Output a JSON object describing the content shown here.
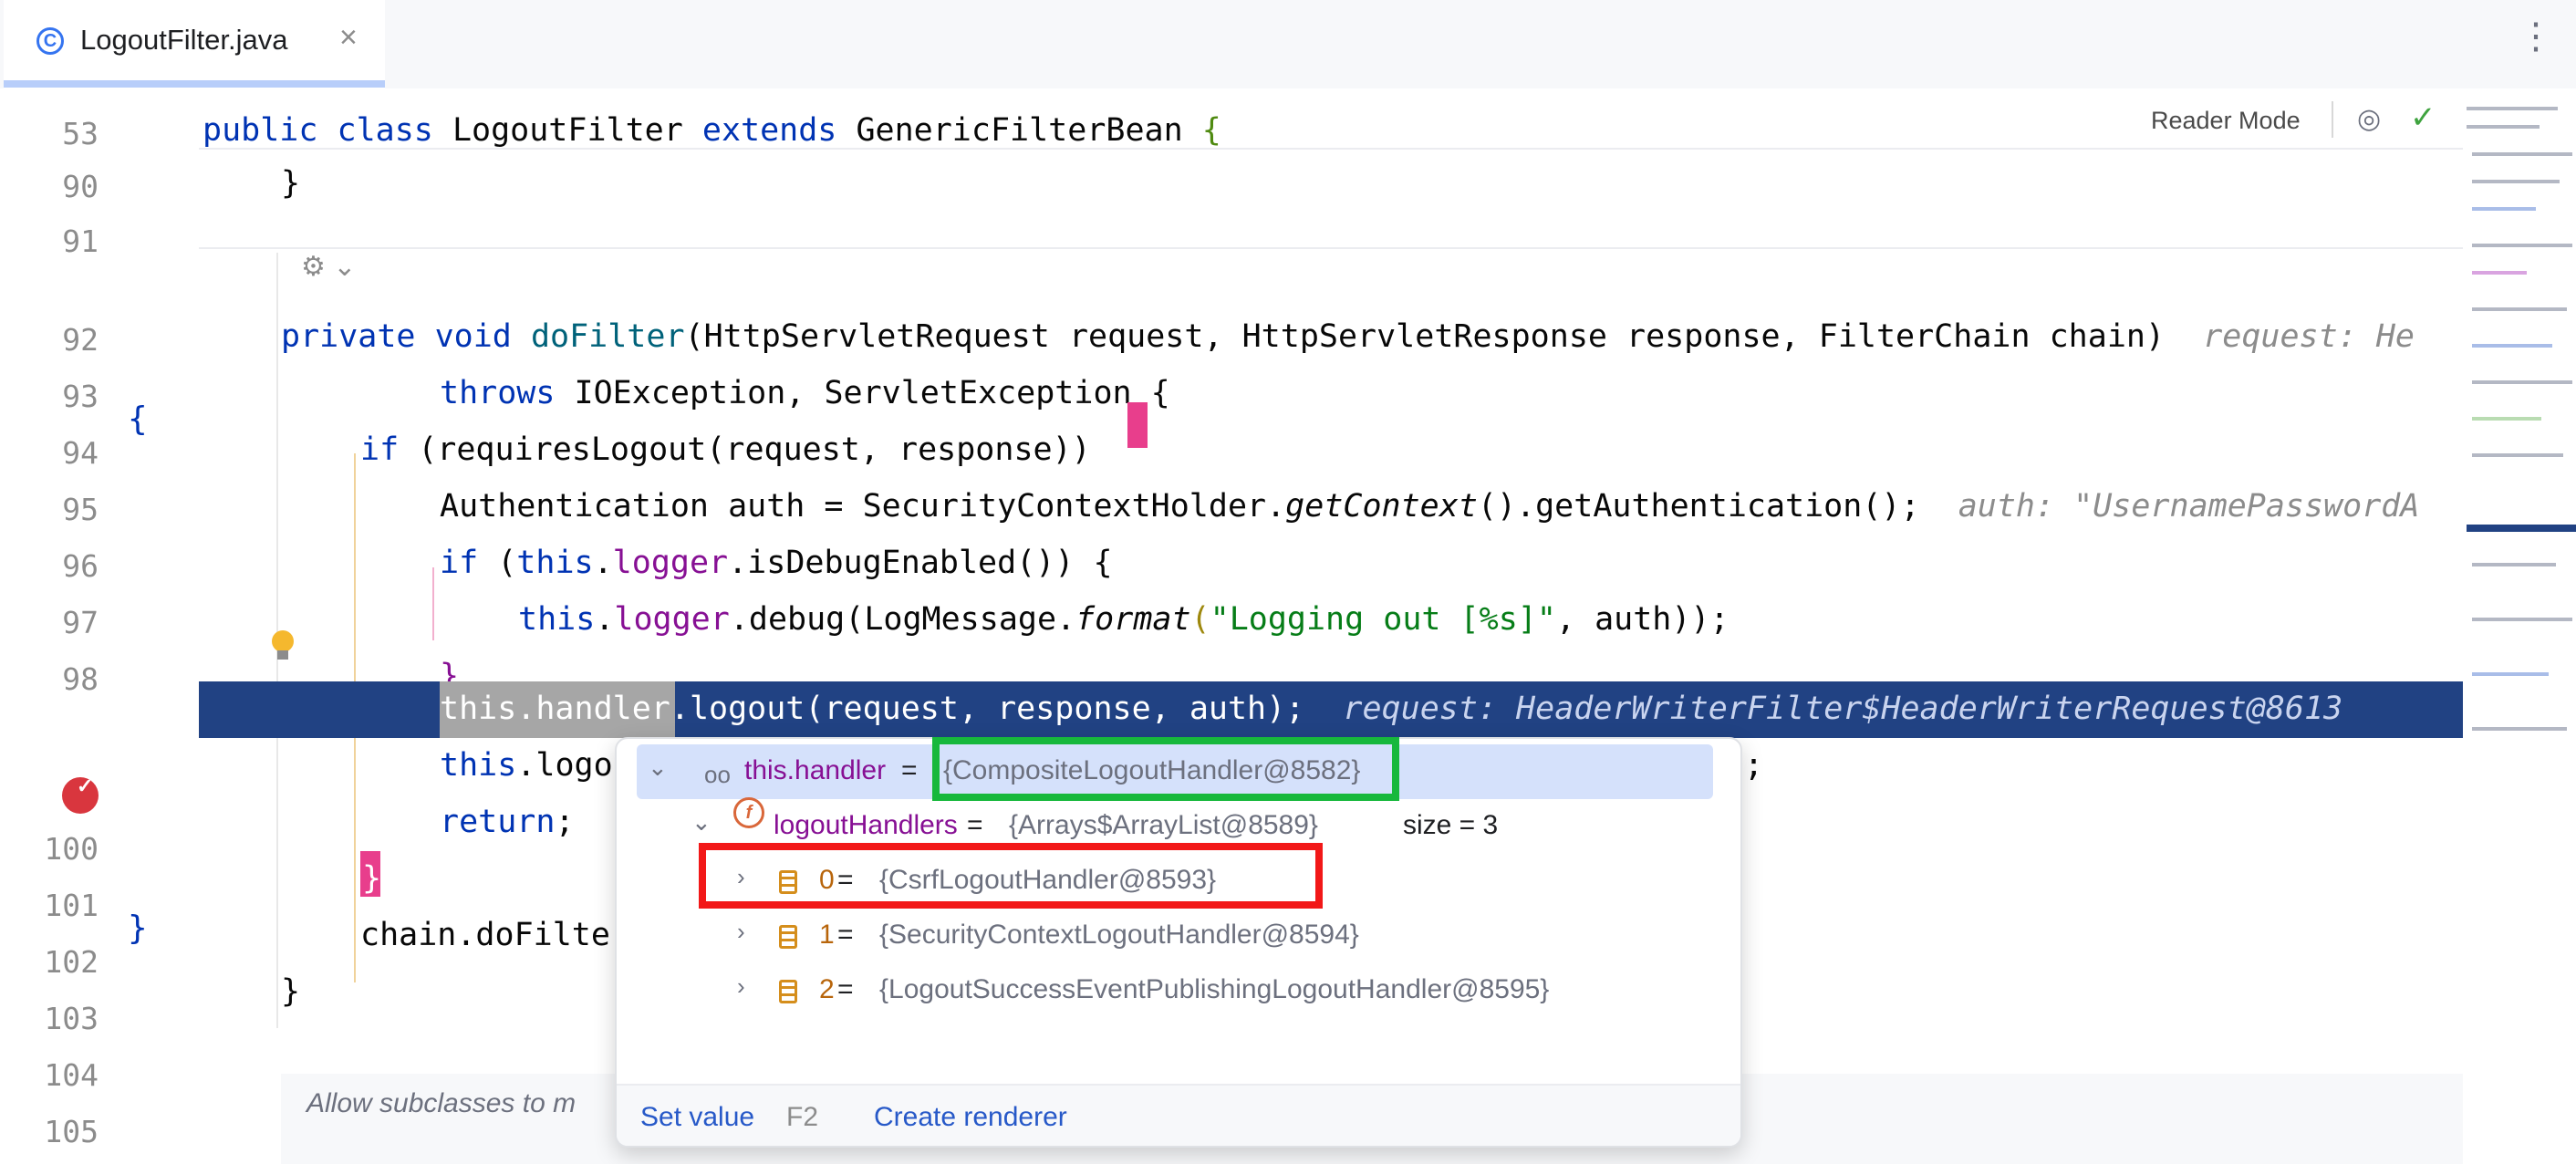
{
  "tab": {
    "icon": "class-icon",
    "label": "LogoutFilter.java",
    "close": "×"
  },
  "menu_glyph": "⋮",
  "reader_mode": {
    "label": "Reader Mode"
  },
  "line_numbers": [
    "53",
    "90",
    "91",
    "92",
    "93",
    "94",
    "95",
    "96",
    "97",
    "98",
    "100",
    "101",
    "102",
    "103",
    "104",
    "105"
  ],
  "fold_markers": {
    "l94": "{",
    "l102": "}"
  },
  "code": {
    "l53_kw1": "public class ",
    "l53_name": "LogoutFilter ",
    "l53_kw2": "extends ",
    "l53_super": "GenericFilterBean ",
    "l53_brace": "{",
    "l90": "}",
    "l92_kw": "private void ",
    "l92_m": "doFilter",
    "l92_rest": "(HttpServletRequest request, HttpServletResponse response, FilterChain chain)",
    "l92_hint": "request: He",
    "l93_kw": "throws ",
    "l93_rest": "IOException, ServletException {",
    "l94_kw": "if ",
    "l94_rest": "(requiresLogout(request, response)) ",
    "l94_brace": "{",
    "l95_a": "Authentication auth = SecurityContextHolder.",
    "l95_m": "getContext",
    "l95_b": "().getAuthentication();",
    "l95_hint": "auth: \"UsernamePasswordA",
    "l96_kw": "if ",
    "l96_a": "(",
    "l96_this": "this",
    "l96_b": ".",
    "l96_fld": "logger",
    "l96_c": ".isDebugEnabled()) {",
    "l97_this": "this",
    "l97_a": ".",
    "l97_fld": "logger",
    "l97_b": ".debug(LogMessage.",
    "l97_m": "format",
    "l97_c": "(",
    "l97_str": "\"Logging out [%s]\"",
    "l97_d": ", auth));",
    "l98": "}",
    "l99_sel": "this.handler",
    "l99_rest": ".logout(request, response, auth);",
    "l99_hint": "request: HeaderWriterFilter$HeaderWriterRequest@8613",
    "l100_this": "this",
    "l100_a": ".logo",
    "l100_tail": ";",
    "l101_kw": "return",
    "l101_rest": ";",
    "l102_brace": "}",
    "l103": "chain.doFilte",
    "l104": "}"
  },
  "doc_comment": "Allow subclasses to m",
  "debug_popup": {
    "root": {
      "key": "this.handler",
      "eq": " = ",
      "value": "{CompositeLogoutHandler@8582}"
    },
    "child": {
      "key": "logoutHandlers",
      "eq": " = ",
      "value": "{Arrays$ArrayList@8589}",
      "size": "size = 3"
    },
    "items": [
      {
        "index": "0",
        "eq": " = ",
        "value": "{CsrfLogoutHandler@8593}"
      },
      {
        "index": "1",
        "eq": " = ",
        "value": "{SecurityContextLogoutHandler@8594}"
      },
      {
        "index": "2",
        "eq": " = ",
        "value": "{LogoutSuccessEventPublishingLogoutHandler@8595}"
      }
    ],
    "footer": {
      "set_value": "Set value",
      "set_value_key": "F2",
      "create_renderer": "Create renderer"
    }
  },
  "colors": {
    "accent": "#3574f0",
    "exec_line": "#214283",
    "annotation_green": "#17b83c",
    "annotation_red": "#f21818"
  }
}
